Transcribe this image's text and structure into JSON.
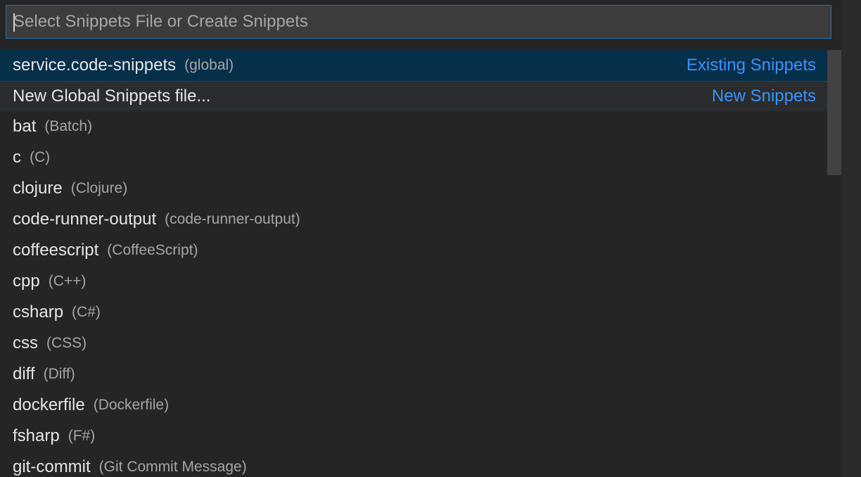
{
  "quick_pick": {
    "placeholder": "Select Snippets File or Create Snippets",
    "value": ""
  },
  "items": [
    {
      "label": "service.code-snippets",
      "description": "(global)",
      "detail": "Existing Snippets"
    },
    {
      "label": "New Global Snippets file...",
      "description": "",
      "detail": "New Snippets"
    },
    {
      "label": "bat",
      "description": "(Batch)",
      "detail": ""
    },
    {
      "label": "c",
      "description": "(C)",
      "detail": ""
    },
    {
      "label": "clojure",
      "description": "(Clojure)",
      "detail": ""
    },
    {
      "label": "code-runner-output",
      "description": "(code-runner-output)",
      "detail": ""
    },
    {
      "label": "coffeescript",
      "description": "(CoffeeScript)",
      "detail": ""
    },
    {
      "label": "cpp",
      "description": "(C++)",
      "detail": ""
    },
    {
      "label": "csharp",
      "description": "(C#)",
      "detail": ""
    },
    {
      "label": "css",
      "description": "(CSS)",
      "detail": ""
    },
    {
      "label": "diff",
      "description": "(Diff)",
      "detail": ""
    },
    {
      "label": "dockerfile",
      "description": "(Dockerfile)",
      "detail": ""
    },
    {
      "label": "fsharp",
      "description": "(F#)",
      "detail": ""
    },
    {
      "label": "git-commit",
      "description": "(Git Commit Message)",
      "detail": ""
    }
  ],
  "colors": {
    "background": "#252526",
    "selected_row": "#062f4a",
    "input_border": "#1f6fb5",
    "detail_text": "#3794ff"
  }
}
